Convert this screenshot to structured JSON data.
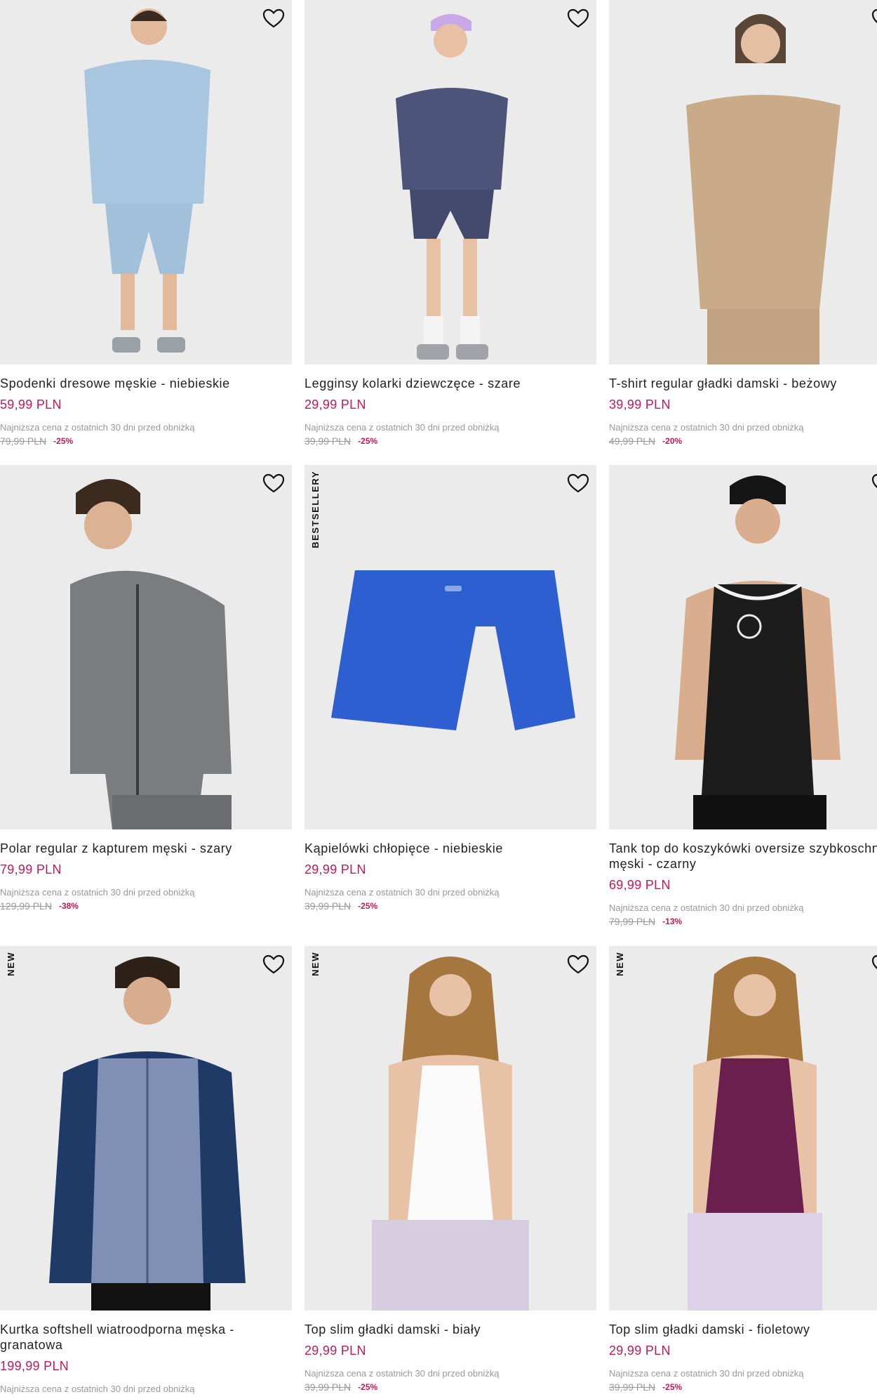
{
  "products": [
    {
      "name": "Spodenki dresowe męskie - niebieskie",
      "price": "59,99 PLN",
      "lowest_label": "Najniższa cena z ostatnich 30 dni przed obniżką",
      "old_price": "79,99 PLN",
      "discount": "-25%",
      "badge": ""
    },
    {
      "name": "Legginsy kolarki dziewczęce - szare",
      "price": "29,99 PLN",
      "lowest_label": "Najniższa cena z ostatnich 30 dni przed obniżką",
      "old_price": "39,99 PLN",
      "discount": "-25%",
      "badge": ""
    },
    {
      "name": "T-shirt regular gładki damski - beżowy",
      "price": "39,99 PLN",
      "lowest_label": "Najniższa cena z ostatnich 30 dni przed obniżką",
      "old_price": "49,99 PLN",
      "discount": "-20%",
      "badge": ""
    },
    {
      "name": "Polar regular z kapturem męski - szary",
      "price": "79,99 PLN",
      "lowest_label": "Najniższa cena z ostatnich 30 dni przed obniżką",
      "old_price": "129,99 PLN",
      "discount": "-38%",
      "badge": ""
    },
    {
      "name": "Kąpielówki chłopięce - niebieskie",
      "price": "29,99 PLN",
      "lowest_label": "Najniższa cena z ostatnich 30 dni przed obniżką",
      "old_price": "39,99 PLN",
      "discount": "-25%",
      "badge": "BESTSELLERY"
    },
    {
      "name": "Tank top do koszykówki oversize szybkoschnący męski - czarny",
      "price": "69,99 PLN",
      "lowest_label": "Najniższa cena z ostatnich 30 dni przed obniżką",
      "old_price": "79,99 PLN",
      "discount": "-13%",
      "badge": ""
    },
    {
      "name": "Kurtka softshell wiatroodporna męska - granatowa",
      "price": "199,99 PLN",
      "lowest_label": "Najniższa cena z ostatnich 30 dni przed obniżką",
      "old_price": "",
      "discount": "",
      "badge": "NEW"
    },
    {
      "name": "Top slim gładki damski - biały",
      "price": "29,99 PLN",
      "lowest_label": "Najniższa cena z ostatnich 30 dni przed obniżką",
      "old_price": "39,99 PLN",
      "discount": "-25%",
      "badge": "NEW"
    },
    {
      "name": "Top slim gładki damski - fioletowy",
      "price": "29,99 PLN",
      "lowest_label": "Najniższa cena z ostatnich 30 dni przed obniżką",
      "old_price": "39,99 PLN",
      "discount": "-25%",
      "badge": "NEW"
    }
  ],
  "colors": {
    "accent": "#c2185b",
    "muted": "#999999",
    "photo_bg": "#ebebeb"
  },
  "icons": {
    "wishlist": "heart-outline-icon"
  }
}
